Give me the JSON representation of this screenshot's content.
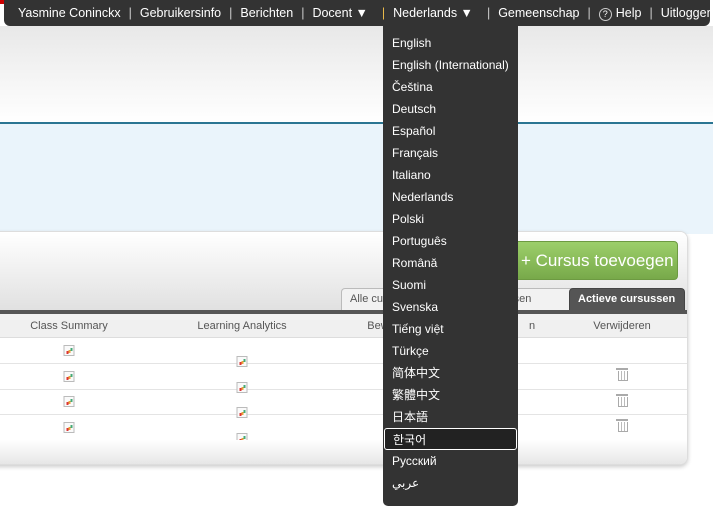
{
  "topbar": {
    "user": "Yasmine Coninckx",
    "profile": "Gebruikersinfo",
    "messages": "Berichten",
    "teacher": "Docent ▼",
    "language": "Nederlands ▼",
    "community": "Gemeenschap",
    "help": "Help",
    "help_icon": "?",
    "logout": "Uitloggen"
  },
  "actions": {
    "add_course": "Cursus toevoegen",
    "add_icon": "plus-icon"
  },
  "tabs": {
    "all": "Alle cu",
    "middle": "ussen",
    "active": "Actieve cursussen"
  },
  "table": {
    "headers": [
      "Class Summary",
      "Learning Analytics",
      "Bew",
      "n",
      "Verwijderen"
    ],
    "rows": 4
  },
  "languages": [
    "English",
    "English (International)",
    "Čeština",
    "Deutsch",
    "Español",
    "Français",
    "Italiano",
    "Nederlands",
    "Polski",
    "Português",
    "Română",
    "Suomi",
    "Svenska",
    "Tiếng việt",
    "Türkçe",
    "简体中文",
    "繁體中文",
    "日本語",
    "한국어",
    "Русский",
    "عربي"
  ],
  "highlighted_language": "한국어",
  "colors": {
    "topbar": "#333333",
    "accent_line": "#2a7592",
    "add_button": "#8bbf5b"
  }
}
